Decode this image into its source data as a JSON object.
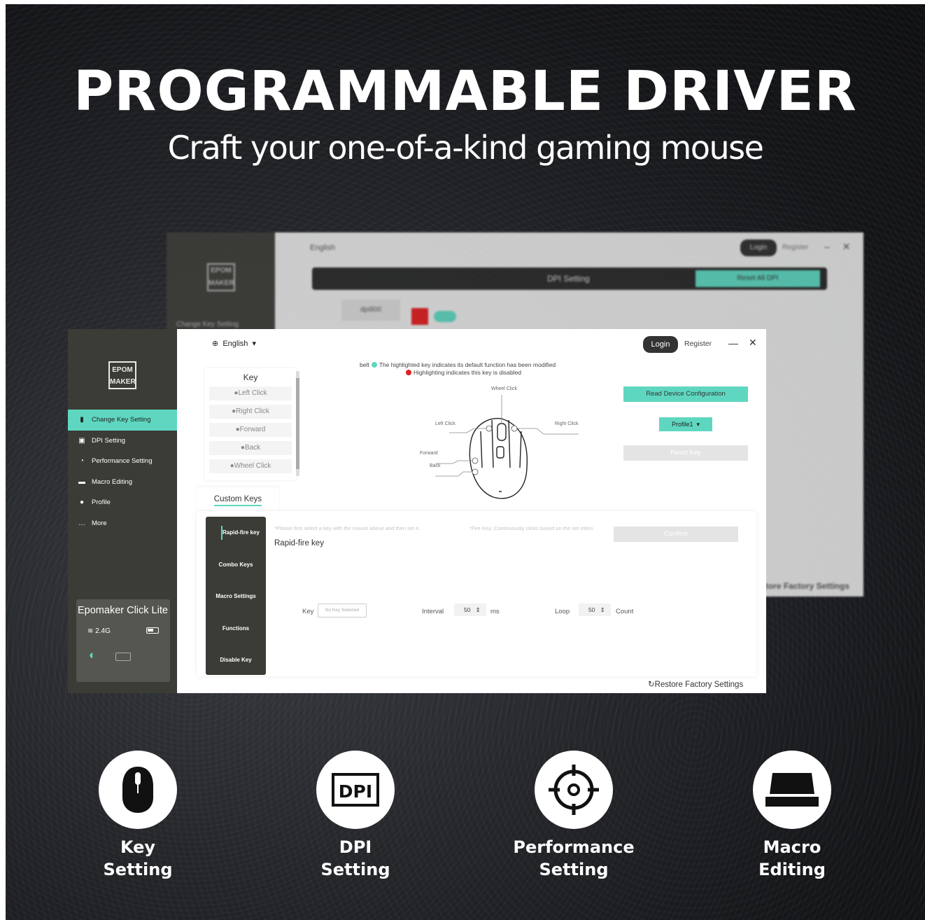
{
  "headline": "PROGRAMMABLE DRIVER",
  "subheadline": "Craft your one-of-a-kind gaming mouse",
  "background_window": {
    "logo_top": "EPOM",
    "logo_bottom": "MAKER",
    "sidebar_item": "Change Key Setting",
    "language": "English",
    "login": "Login",
    "register": "Register",
    "bar_title": "DPI Setting",
    "bar_button": "Reset All DPI",
    "dpi_label": "dpi800",
    "restore": "tore Factory Settings"
  },
  "app": {
    "logo_top": "EPOM",
    "logo_bottom": "MAKER",
    "sidebar": [
      {
        "label": "Change Key Setting",
        "icon": "mouse-icon"
      },
      {
        "label": "DPI Setting",
        "icon": "dpi-icon"
      },
      {
        "label": "Performance Setting",
        "icon": "gauge-icon"
      },
      {
        "label": "Macro Editing",
        "icon": "keyboard-icon"
      },
      {
        "label": "Profile",
        "icon": "user-icon"
      },
      {
        "label": "More",
        "icon": "more-icon"
      }
    ],
    "device": {
      "name": "Epomaker Click Lite",
      "connection": "2.4G"
    },
    "topbar": {
      "language": "English",
      "login": "Login",
      "register": "Register",
      "minimize": "—",
      "close": "✕"
    },
    "key_list": {
      "title": "Key",
      "items": [
        "Left Click",
        "Right Click",
        "Forward",
        "Back",
        "Wheel Click"
      ]
    },
    "legend": {
      "line1_prefix": "belt",
      "line1": "The highlighted key indicates its default function has been modified",
      "line2": "Highlighting indicates this key is disabled"
    },
    "mouse_labels": {
      "wheel": "Wheel Click",
      "left": "Left Click",
      "right": "Right Click",
      "forward": "Forward",
      "back": "Back"
    },
    "buttons": {
      "read": "Read Device Configuration",
      "profile": "Profile1",
      "reset": "Reset Key",
      "confirm": "Confirm"
    },
    "tab": "Custom Keys",
    "subnav": [
      "Rapid-fire key",
      "Combo Keys",
      "Macro Settings",
      "Functions",
      "Disable Key"
    ],
    "hint1": "*Please first select a key with the mouse above and then set it.",
    "hint2": "*Fire Key: Continuously clicks based on the set interv",
    "rapid_title": "Rapid-fire key",
    "fields": {
      "key_label": "Key",
      "key_placeholder": "No Key Selected",
      "interval_label": "Interval",
      "interval_value": "50",
      "interval_unit": "ms",
      "loop_label": "Loop",
      "loop_value": "50",
      "loop_unit": "Count"
    },
    "restore": "Restore Factory Settings"
  },
  "features": [
    {
      "line1": "Key",
      "line2": "Setting",
      "icon": "mouse-icon"
    },
    {
      "line1": "DPI",
      "line2": "Setting",
      "icon": "dpi-icon"
    },
    {
      "line1": "Performance",
      "line2": "Setting",
      "icon": "crosshair-icon"
    },
    {
      "line1": "Macro",
      "line2": "Editing",
      "icon": "keyboard-icon"
    }
  ],
  "colors": {
    "accent": "#5fd7c0",
    "disabled": "#e02020",
    "sidebar": "#3b3c36"
  }
}
